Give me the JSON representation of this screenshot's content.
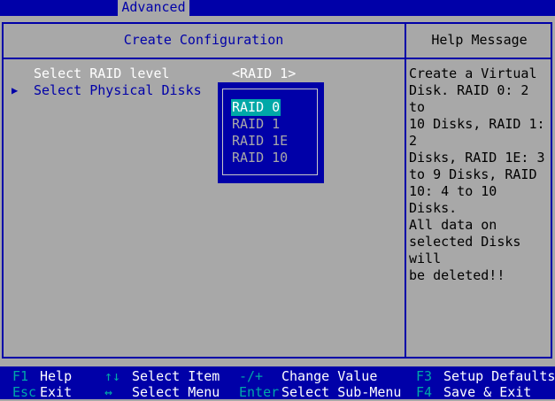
{
  "header": {
    "active_tab": "Advanced"
  },
  "left_panel": {
    "title": "Create Configuration",
    "items": [
      {
        "label": "Select RAID level",
        "value": "<RAID 1>"
      },
      {
        "label": "Select Physical Disks"
      }
    ]
  },
  "help_panel": {
    "title": "Help Message",
    "text": "Create a Virtual\nDisk. RAID 0: 2 to\n10 Disks, RAID 1: 2\nDisks, RAID 1E: 3\nto 9 Disks, RAID\n10: 4 to 10 Disks.\nAll data on\nselected Disks will\nbe deleted!!"
  },
  "popup": {
    "options": [
      "RAID 0",
      "RAID 1",
      "RAID 1E",
      "RAID 10"
    ],
    "selected_index": 0
  },
  "footer": {
    "keys": [
      {
        "key": "F1",
        "desc": "Help"
      },
      {
        "key": "Esc",
        "desc": "Exit"
      },
      {
        "key": "↑↓",
        "desc": "Select Item"
      },
      {
        "key": "↔",
        "desc": "Select Menu"
      },
      {
        "key": "-/+",
        "desc": "Change Value"
      },
      {
        "key": "Enter",
        "desc": "Select Sub-Menu"
      },
      {
        "key": "F3",
        "desc": "Setup Defaults"
      },
      {
        "key": "F4",
        "desc": "Save & Exit"
      }
    ]
  },
  "colors": {
    "bios_blue": "#0000a8",
    "bios_gray": "#a8a8a8",
    "highlight_cyan": "#00a8a8",
    "text_white": "#ffffff"
  }
}
